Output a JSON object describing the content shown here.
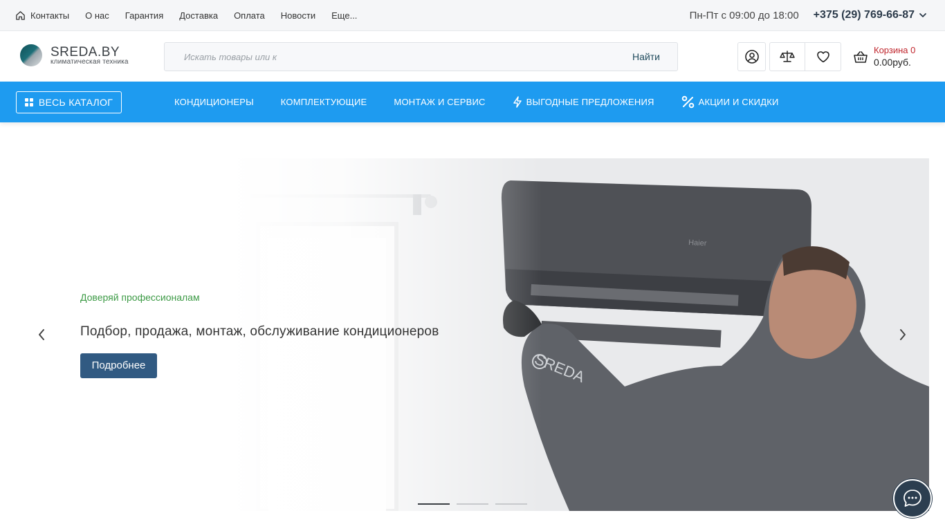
{
  "topbar": {
    "nav": [
      {
        "label": "Контакты",
        "icon": "home-icon"
      },
      {
        "label": "О нас"
      },
      {
        "label": "Гарантия"
      },
      {
        "label": "Доставка"
      },
      {
        "label": "Оплата"
      },
      {
        "label": "Новости"
      },
      {
        "label": "Еще..."
      }
    ],
    "hours": "Пн-Пт с 09:00 до 18:00",
    "phone": "+375 (29) 769-66-87"
  },
  "header": {
    "logo_title": "SREDA.BY",
    "logo_subtitle": "климатическая техника",
    "search_placeholder": "Искать товары или к",
    "search_button": "Найти",
    "cart_label": "Корзина 0",
    "cart_total": "0.00руб."
  },
  "menu": {
    "catalog_label": "ВЕСЬ КАТАЛОГ",
    "items": [
      {
        "label": "КОНДИЦИОНЕРЫ"
      },
      {
        "label": "КОМПЛЕКТУЮЩИЕ"
      },
      {
        "label": "МОНТАЖ И СЕРВИС"
      },
      {
        "label": "ВЫГОДНЫЕ ПРЕДЛОЖЕНИЯ",
        "icon": "lightning-icon"
      },
      {
        "label": "АКЦИИ И СКИДКИ",
        "icon": "percent-icon"
      }
    ]
  },
  "hero": {
    "kicker": "Доверяй профессионалам",
    "title": "Подбор, продажа, монтаж, обслуживание кондиционеров",
    "button": "Подробнее",
    "unit_brand": "Haier",
    "sleeve_brand": "SREDA",
    "slide_count": 3,
    "active_slide": 1
  },
  "colors": {
    "menu_blue": "#1e9bf0",
    "hero_button": "#315a82",
    "kicker_green": "#3c9a45",
    "cart_red": "#c0262d",
    "chat_dark": "#2c3e50"
  }
}
